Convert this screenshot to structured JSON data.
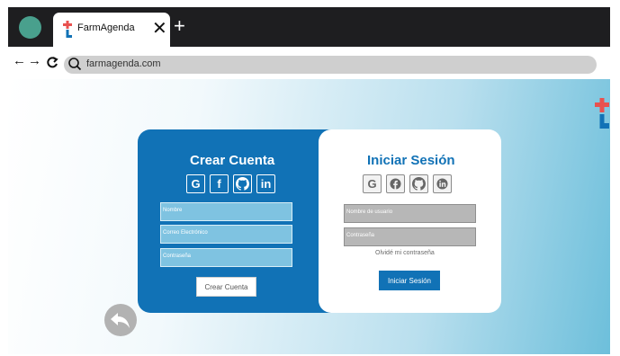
{
  "browser": {
    "tab_title": "FarmAgenda",
    "close_glyph": "✕",
    "new_tab_glyph": "+",
    "back_glyph": "←",
    "forward_glyph": "→",
    "url": "farmagenda.com"
  },
  "signup": {
    "title": "Crear Cuenta",
    "social": [
      "google-icon",
      "facebook-icon",
      "github-icon",
      "linkedin-icon"
    ],
    "name_placeholder": "Nombre",
    "email_placeholder": "Correo Electrónico",
    "password_placeholder": "Contraseña",
    "button_label": "Crear Cuenta"
  },
  "login": {
    "title": "Iniciar Sesión",
    "social": [
      "google-icon",
      "facebook-icon",
      "github-icon",
      "linkedin-icon"
    ],
    "username_placeholder": "Nombre de usuario",
    "password_placeholder": "Contraseña",
    "forgot_label": "Olvidé mi contraseña",
    "button_label": "Iniciar Sesión"
  },
  "colors": {
    "primary": "#1172b6",
    "brand_red": "#e8514f",
    "brand_blue": "#1172b6",
    "tab_dot": "#49a08d"
  }
}
